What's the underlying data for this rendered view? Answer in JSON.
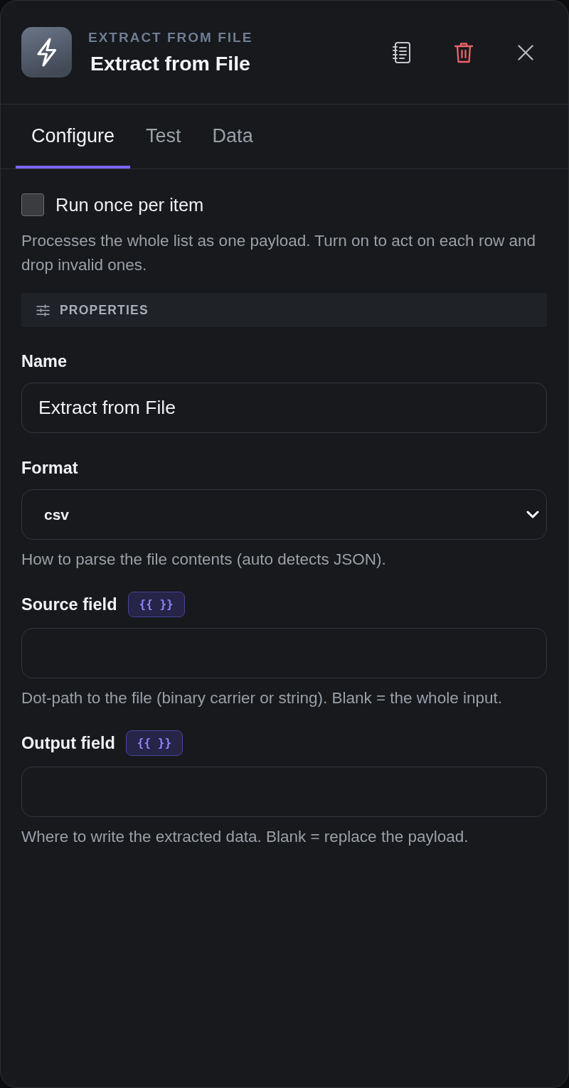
{
  "header": {
    "kicker": "EXTRACT FROM FILE",
    "title": "Extract from File"
  },
  "tabs": [
    {
      "label": "Configure",
      "selected": true
    },
    {
      "label": "Test",
      "selected": false
    },
    {
      "label": "Data",
      "selected": false
    }
  ],
  "run_once": {
    "label": "Run once per item",
    "checked": false,
    "help": "Processes the whole list as one payload. Turn on to act on each row and drop invalid ones."
  },
  "section": {
    "title": "PROPERTIES"
  },
  "fields": [
    {
      "kind": "text",
      "label": "Name",
      "value": "Extract from File"
    },
    {
      "kind": "select",
      "label": "Format",
      "value": "csv",
      "help": "How to parse the file contents (auto detects JSON)."
    },
    {
      "kind": "text",
      "label": "Source field",
      "badge": "{{ }}",
      "help": "Dot-path to the file (binary carrier or string). Blank = the whole input."
    },
    {
      "kind": "text",
      "label": "Output field",
      "badge": "{{ }}",
      "help": "Where to write the extracted data. Blank = replace the payload."
    }
  ]
}
